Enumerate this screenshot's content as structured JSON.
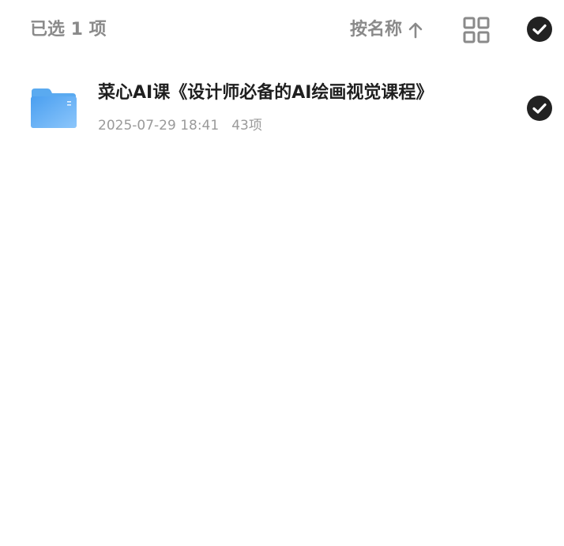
{
  "header": {
    "selected_label": "已选 1 项",
    "sort_label": "按名称",
    "sort_direction_icon": "arrow-up-icon",
    "view_toggle_icon": "grid-view-icon",
    "select_all_icon": "check-circle-icon",
    "select_all_checked": true
  },
  "files": [
    {
      "name": "菜心AI课《设计师必备的AI绘画视觉课程》",
      "date": "2025-07-29 18:41",
      "count": "43项",
      "type_icon": "folder-icon",
      "selected": true
    }
  ],
  "colors": {
    "muted_text": "#8a8a8a",
    "title_text": "#1f1f1f",
    "meta_text": "#9a9a9a",
    "check_fill": "#222222",
    "folder_blue": "#5aaaf0"
  }
}
